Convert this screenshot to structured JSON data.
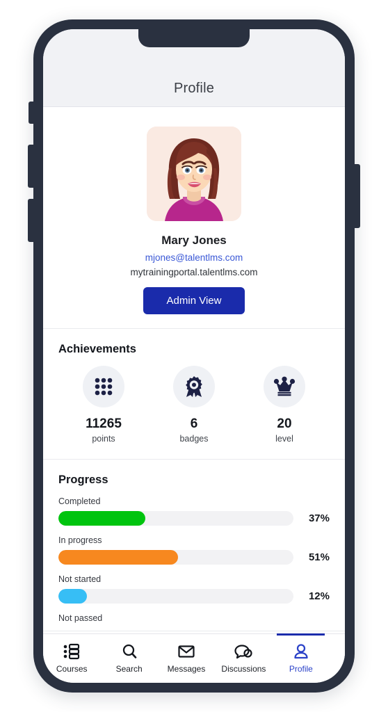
{
  "header": {
    "title": "Profile"
  },
  "profile": {
    "avatar_icon": "user-avatar-illustration",
    "name": "Mary Jones",
    "email": "mjones@talentlms.com",
    "portal_url": "mytrainingportal.talentlms.com",
    "admin_button_label": "Admin View",
    "email_color": "#3a58d6",
    "button_color": "#1a2bab"
  },
  "achievements": {
    "title": "Achievements",
    "items": [
      {
        "icon": "dot-grid-icon",
        "value": "11265",
        "label": "points"
      },
      {
        "icon": "badge-ribbon-icon",
        "value": "6",
        "label": "badges"
      },
      {
        "icon": "crown-icon",
        "value": "20",
        "label": "level"
      }
    ]
  },
  "progress": {
    "title": "Progress",
    "rows": [
      {
        "label": "Completed",
        "percent": "37%",
        "value": 37,
        "color": "#00c40f"
      },
      {
        "label": "In progress",
        "percent": "51%",
        "value": 51,
        "color": "#f7881f"
      },
      {
        "label": "Not started",
        "percent": "12%",
        "value": 12,
        "color": "#37bef5"
      },
      {
        "label": "Not passed",
        "percent": "",
        "value": 0,
        "color": "#e0443e"
      }
    ]
  },
  "bottom_nav": {
    "items": [
      {
        "icon": "courses-list-icon",
        "label": "Courses",
        "active": false
      },
      {
        "icon": "search-icon",
        "label": "Search",
        "active": false
      },
      {
        "icon": "envelope-icon",
        "label": "Messages",
        "active": false
      },
      {
        "icon": "chat-bubbles-icon",
        "label": "Discussions",
        "active": false
      },
      {
        "icon": "person-icon",
        "label": "Profile",
        "active": true
      }
    ],
    "active_color": "#2b42c8"
  }
}
